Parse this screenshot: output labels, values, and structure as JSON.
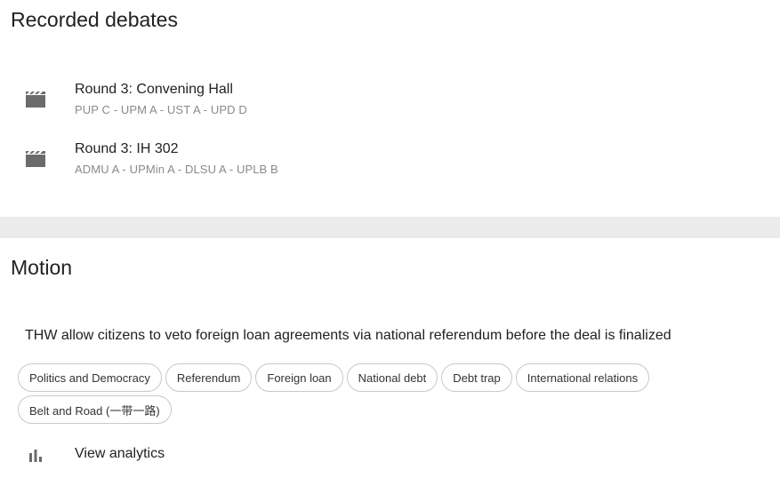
{
  "recorded": {
    "title": "Recorded debates",
    "items": [
      {
        "title": "Round 3: Convening Hall",
        "teams": "PUP C - UPM A - UST A - UPD D",
        "icon": "movie-clapper-icon"
      },
      {
        "title": "Round 3: IH 302",
        "teams": "ADMU A - UPMin A - DLSU A - UPLB B",
        "icon": "movie-clapper-icon"
      }
    ]
  },
  "motion": {
    "title": "Motion",
    "text": "THW allow citizens to veto foreign loan agreements via national referendum before the deal is finalized",
    "tags": [
      "Politics and Democracy",
      "Referendum",
      "Foreign loan",
      "National debt",
      "Debt trap",
      "International relations",
      "Belt and Road (一带一路)"
    ]
  },
  "analytics": {
    "label": "View analytics",
    "icon": "bar-chart-icon"
  },
  "colors": {
    "divider": "#ebebeb",
    "icon": "#6b6b6b",
    "secondary_text": "#8a8a8a",
    "chip_border": "#c8c8c8"
  }
}
